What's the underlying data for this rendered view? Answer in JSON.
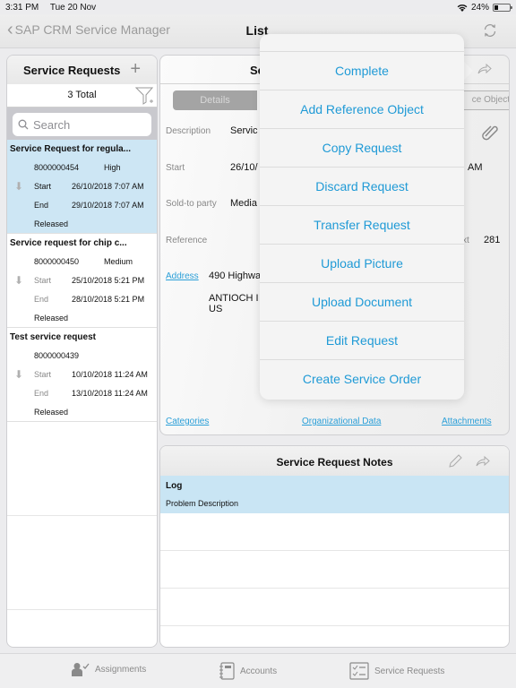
{
  "status_bar": {
    "time": "3:31 PM",
    "date": "Tue 20 Nov",
    "battery_percent": "24%",
    "battery_level": 0.24,
    "icons": [
      "wifi-icon",
      "battery-icon"
    ]
  },
  "nav_bar": {
    "back_label": "SAP CRM Service Manager",
    "title": "List",
    "refresh_icon": "refresh-icon"
  },
  "left_panel": {
    "title": "Service Requests",
    "add_icon": "plus-icon",
    "total": "3 Total",
    "filter_icon": "filter-icon",
    "search_placeholder": "Search",
    "items": [
      {
        "title": "Service Request for regula...",
        "id": "8000000454",
        "priority": "High",
        "start_label": "Start",
        "start": "26/10/2018 7:07 AM",
        "end_label": "End",
        "end": "29/10/2018 7:07 AM",
        "status": "Released",
        "selected": true
      },
      {
        "title": "Service request for chip c...",
        "id": "8000000450",
        "priority": "Medium",
        "start_label": "Start",
        "start": "25/10/2018 5:21 PM",
        "end_label": "End",
        "end": "28/10/2018 5:21 PM",
        "status": "Released",
        "selected": false
      },
      {
        "title": "Test service request",
        "id": "8000000439",
        "priority": "",
        "start_label": "Start",
        "start": "10/10/2018 11:24 AM",
        "end_label": "End",
        "end": "13/10/2018 11:24 AM",
        "status": "Released",
        "selected": false
      }
    ]
  },
  "detail_panel": {
    "title_partial": "Se",
    "tabs": {
      "details": "Details",
      "reference_objects_partial": "ce Objects"
    },
    "fields": {
      "description_label": "Description",
      "description_value": "Servic",
      "start_label": "Start",
      "start_value": "26/10/",
      "start_value_tail": "AM",
      "sold_to_label": "Sold-to party",
      "sold_to_value": "Media",
      "reference_label": "Reference",
      "reference_right_label": "xt",
      "reference_right_value": "281",
      "address_link": "Address",
      "address_line1": "490 Highwa",
      "address_line2": "ANTIOCH I",
      "address_line3": "US"
    },
    "links": {
      "categories": "Categories",
      "organizational_data": "Organizational Data",
      "attachments": "Attachments"
    }
  },
  "notes_panel": {
    "title": "Service Request Notes",
    "log_title": "Log",
    "log_description": "Problem Description"
  },
  "action_menu": {
    "items": [
      "Complete",
      "Add Reference Object",
      "Copy Request",
      "Discard Request",
      "Transfer Request",
      "Upload Picture",
      "Upload Document",
      "Edit Request",
      "Create Service Order"
    ]
  },
  "tab_bar": {
    "tabs": [
      {
        "label": "Assignments",
        "icon": "assignments-icon"
      },
      {
        "label": "Accounts",
        "icon": "accounts-icon"
      },
      {
        "label": "Service Requests",
        "icon": "service-requests-icon"
      }
    ]
  },
  "colors": {
    "accent": "#1f9ad6",
    "link": "#2a9fd8",
    "selected_row": "#cde6f4"
  }
}
